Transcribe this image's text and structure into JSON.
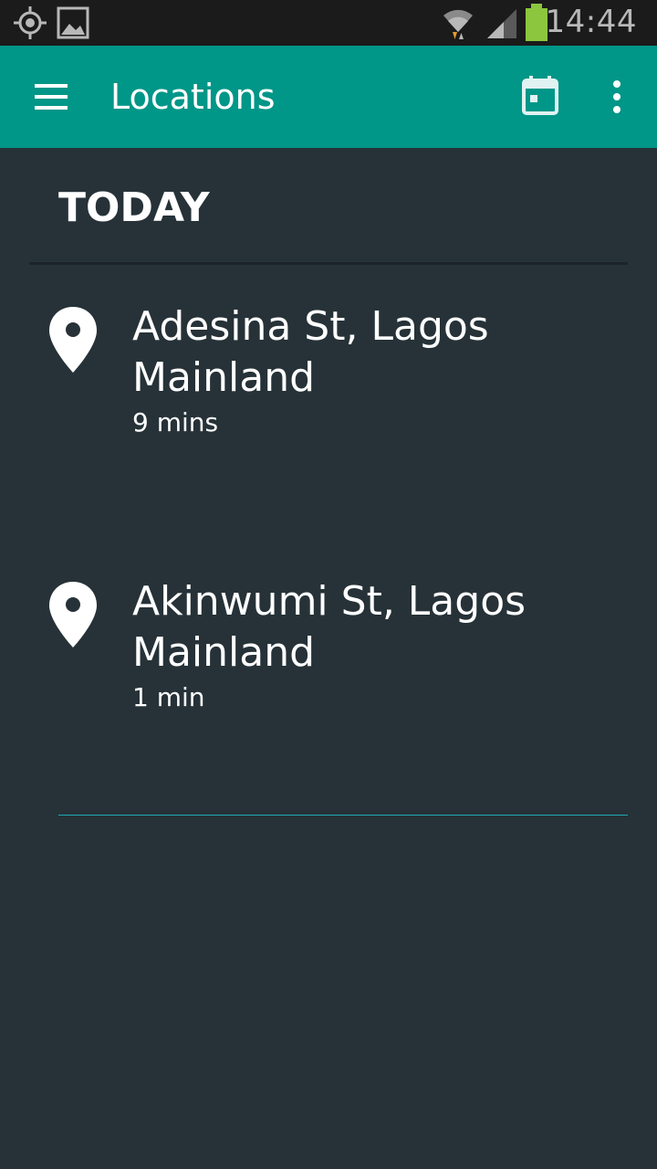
{
  "status_bar": {
    "time": "14:44",
    "icons": [
      "location-icon",
      "image-icon",
      "wifi-icon",
      "signal-icon",
      "battery-icon"
    ],
    "battery_color": "#8cc63f"
  },
  "app_bar": {
    "title": "Locations",
    "color": "#009688",
    "actions": [
      "calendar-icon",
      "more-vert-icon"
    ]
  },
  "section": {
    "header": "TODAY"
  },
  "locations": [
    {
      "name": "Adesina St, Lagos Mainland",
      "duration": "9 mins",
      "icon": "map-pin-icon"
    },
    {
      "name": "Akinwumi St, Lagos Mainland",
      "duration": "1 min",
      "icon": "map-pin-icon"
    }
  ],
  "colors": {
    "background": "#263238",
    "accent_divider": "#1ea7b3"
  }
}
